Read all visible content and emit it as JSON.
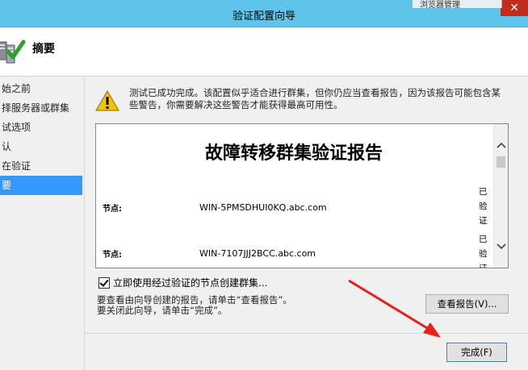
{
  "window": {
    "title": "验证配置向导",
    "close_glyph": "✕",
    "background_window_label": "浏览器管理"
  },
  "header": {
    "title": "摘要",
    "icon": "cluster-validation-checkmark-icon"
  },
  "sidebar": {
    "items": [
      {
        "label": "始之前",
        "active": false
      },
      {
        "label": "择服务器或群集",
        "active": false
      },
      {
        "label": "试选项",
        "active": false
      },
      {
        "label": "认",
        "active": false
      },
      {
        "label": "在验证",
        "active": false
      },
      {
        "label": "要",
        "active": true
      }
    ]
  },
  "content": {
    "warning_text": "测试已成功完成。该配置似乎适合进行群集，但你仍应当查看报告，因为该报告可能包含某些警告，你需要解决这些警告才能获得最高可用性。",
    "report": {
      "title": "故障转移群集验证报告",
      "nodes": [
        {
          "label": "节点:",
          "value": "WIN-5PMSDHUI0KQ.abc.com",
          "status": "已验证"
        },
        {
          "label": "节点:",
          "value": "WIN-7107JJJ2BCC.abc.com",
          "status": "已验证"
        }
      ]
    },
    "create_cluster_checkbox": {
      "label": "立即使用经过验证的节点创建群集...",
      "checked": true
    },
    "info_line1": "要查看由向导创建的报告，请单击“查看报告”。",
    "info_line2": "要关闭此向导，请单击“完成”。",
    "view_report_button": "查看报告(V)...",
    "finish_button": "完成(F)"
  },
  "colors": {
    "titlebar": "#5fc4e9",
    "active_item": "#3399ff",
    "close_button": "#c42b1c",
    "annotation_arrow": "#e8201a"
  }
}
